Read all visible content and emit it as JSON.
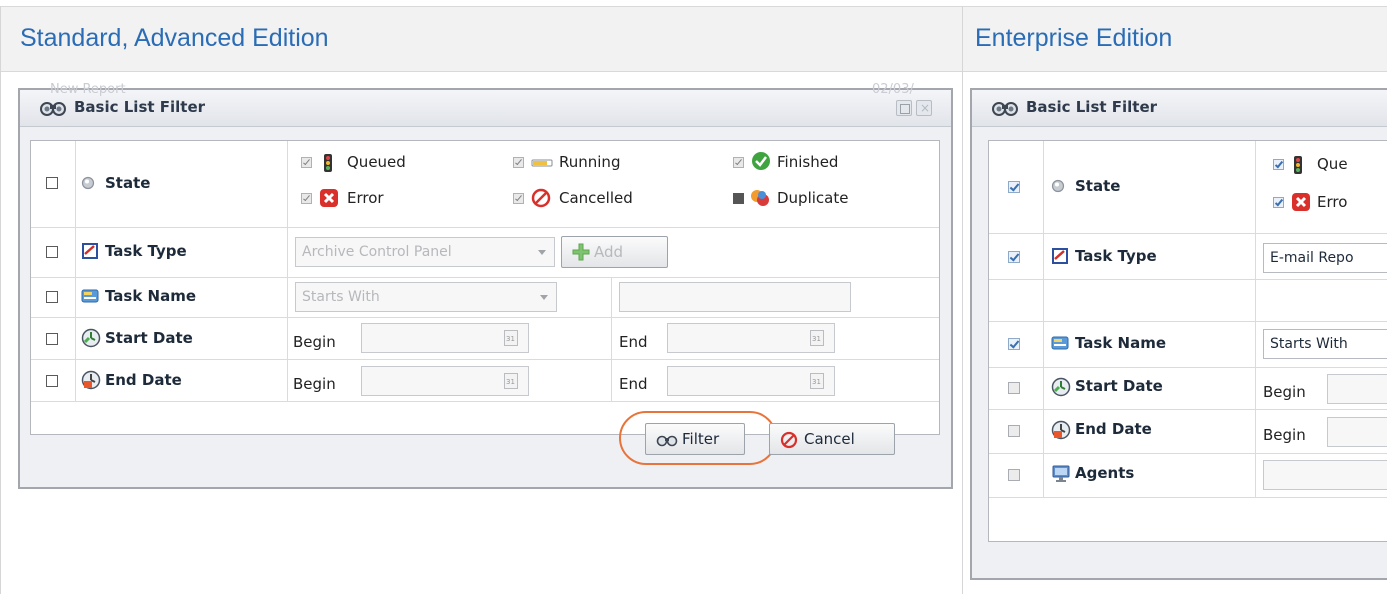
{
  "headers": {
    "left": "Standard, Advanced Edition",
    "right": "Enterprise Edition"
  },
  "left_dialog": {
    "ghost_left": "New Report",
    "ghost_right": "02/03/",
    "title": "Basic List Filter",
    "rows": {
      "state": {
        "label": "State"
      },
      "task_type": {
        "label": "Task Type"
      },
      "task_name": {
        "label": "Task Name"
      },
      "start_date": {
        "label": "Start Date"
      },
      "end_date": {
        "label": "End Date"
      }
    },
    "states": {
      "queued": "Queued",
      "running": "Running",
      "finished": "Finished",
      "error": "Error",
      "cancelled": "Cancelled",
      "duplicate": "Duplicate"
    },
    "task_type_select": "Archive Control Panel",
    "add_button": "Add",
    "task_name_select": "Starts With",
    "begin_label": "Begin",
    "end_label": "End",
    "calendar_day": "31",
    "filter_button": "Filter",
    "cancel_button": "Cancel"
  },
  "right_dialog": {
    "title": "Basic List Filter",
    "rows": {
      "state": {
        "label": "State"
      },
      "task_type": {
        "label": "Task Type"
      },
      "task_name": {
        "label": "Task Name"
      },
      "start_date": {
        "label": "Start Date"
      },
      "end_date": {
        "label": "End Date"
      },
      "agents": {
        "label": "Agents"
      }
    },
    "states": {
      "queued": "Que",
      "error": "Erro"
    },
    "task_type_select": "E-mail Repo",
    "task_name_select": "Starts With",
    "begin_label": "Begin"
  }
}
